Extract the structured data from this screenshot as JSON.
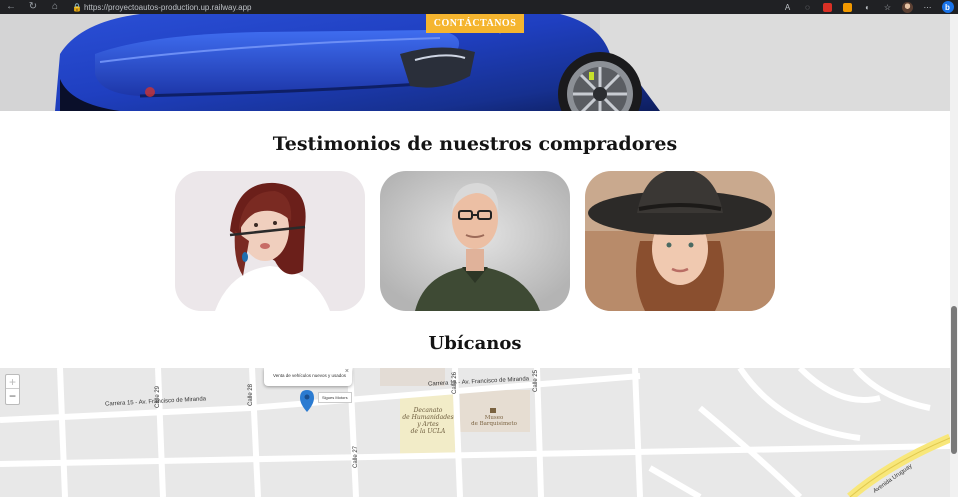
{
  "browser": {
    "url": "https://proyectoautos-production.up.railway.app",
    "bing_label": "b"
  },
  "hero": {
    "cta_label": "CONTÁCTANOS"
  },
  "testimonials": {
    "title": "Testimonios de nuestros compradores"
  },
  "location": {
    "title": "Ubícanos"
  },
  "map": {
    "zoom_in": "+",
    "zoom_out": "−",
    "popup_text": "Venta de vehículos nuevos y usados",
    "popup_close": "×",
    "marker_tag": "Sigues Motors",
    "streets": {
      "carrera15_left": "Carrera 15 - Av. Francisco de Miranda",
      "carrera15_right": "Carrera 15 - Av. Francisco de Miranda",
      "calle29": "Calle 29",
      "calle28": "Calle 28",
      "calle27": "Calle 27",
      "calle26": "Calle 26",
      "calle25": "Calle 25",
      "uruguay": "Avenida Uruguay"
    },
    "poi_ucla": [
      "Decanato",
      "de Humanidades",
      "y Artes",
      "de la UCLA"
    ],
    "poi_museum": [
      "Museo",
      "de Barquisimeto"
    ]
  }
}
